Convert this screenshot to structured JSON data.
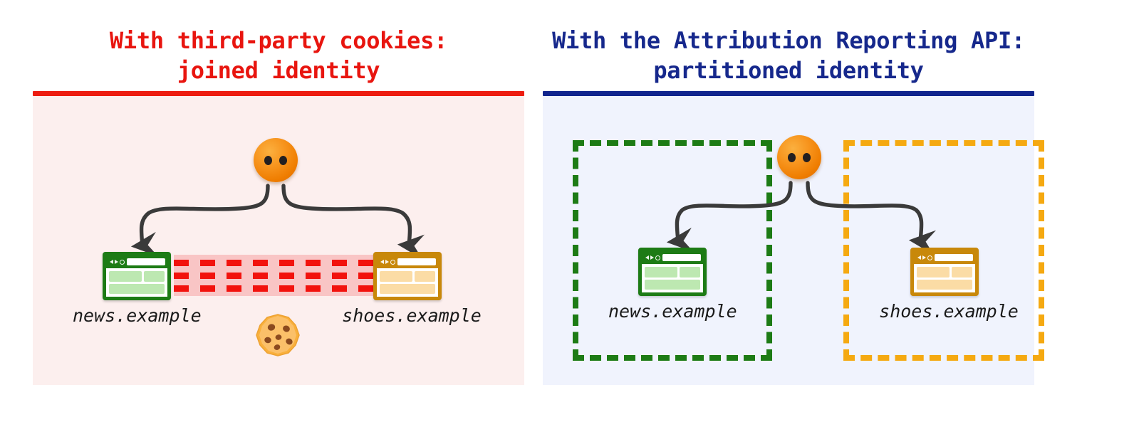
{
  "panels": [
    {
      "id": "third-party-cookies",
      "title": "With third-party cookies:\njoined identity",
      "accent_color": "#ed1c10",
      "background_color": "#fcefee",
      "sites": [
        {
          "label": "news.example",
          "window_color": "#1d7b15"
        },
        {
          "label": "shoes.example",
          "window_color": "#c8880a"
        }
      ],
      "avatar": {
        "icon": "user-face-icon",
        "color": "#f7941d"
      },
      "cookie": {
        "icon": "cookie-icon",
        "emoji": "🍪"
      },
      "connection": {
        "type": "joined-identity-band",
        "band_color": "#f9c5c5",
        "dash_color": "#f2120d",
        "dash_rows": 3
      },
      "arrows": 2
    },
    {
      "id": "attribution-reporting-api",
      "title": "With the Attribution Reporting API:\npartitioned identity",
      "accent_color": "#11258e",
      "background_color": "#f0f3fd",
      "sites": [
        {
          "label": "news.example",
          "window_color": "#1d7b15",
          "partition_color": "#1d7b15"
        },
        {
          "label": "shoes.example",
          "window_color": "#c8880a",
          "partition_color": "#f5a911"
        }
      ],
      "avatar": {
        "icon": "user-face-icon",
        "color": "#f7941d"
      },
      "connection": {
        "type": "partitioned-boxes",
        "partitions": 2
      },
      "arrows": 2
    }
  ]
}
